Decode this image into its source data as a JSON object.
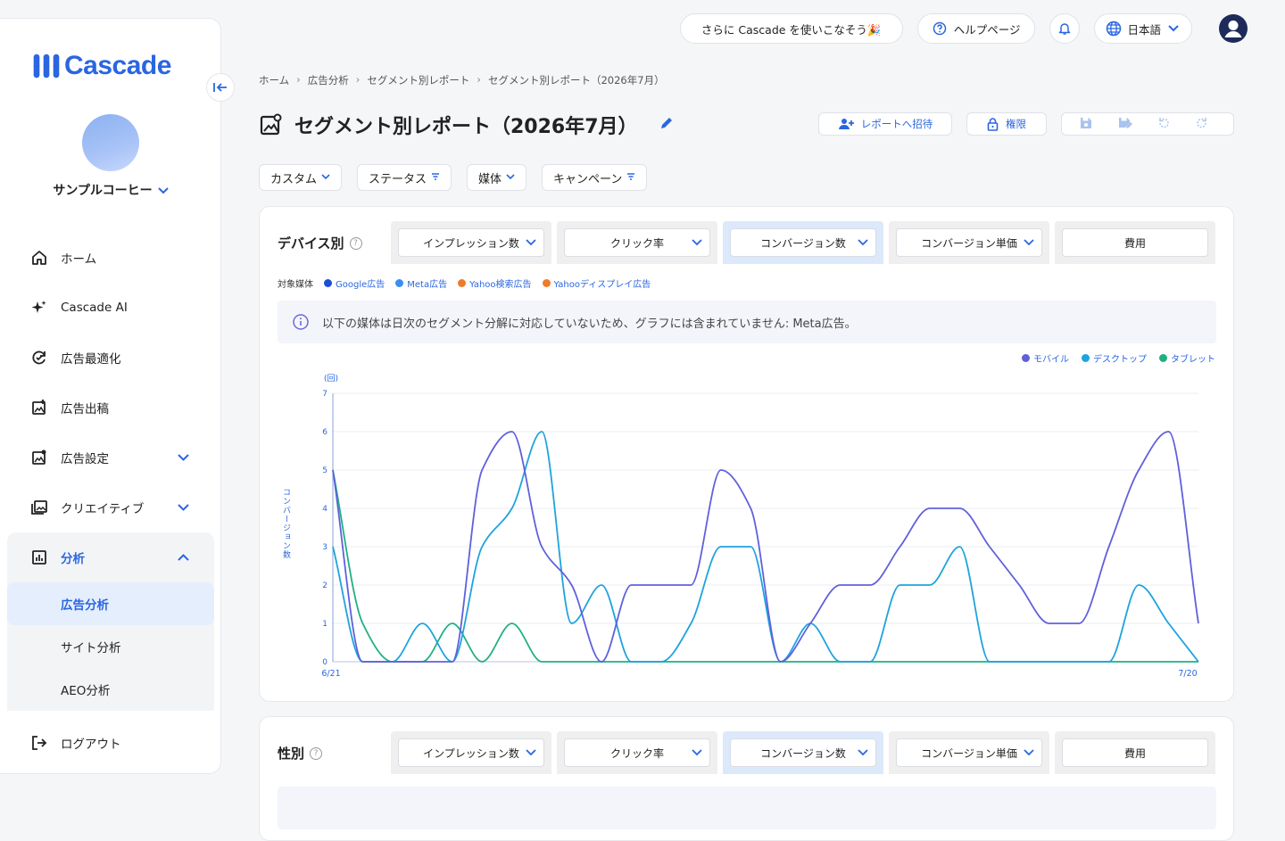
{
  "brand": {
    "name": "Cascade"
  },
  "account": {
    "name": "サンプルコーヒー"
  },
  "nav": {
    "items": [
      {
        "label": "ホーム"
      },
      {
        "label": "Cascade AI"
      },
      {
        "label": "広告最適化"
      },
      {
        "label": "広告出稿"
      },
      {
        "label": "広告設定"
      },
      {
        "label": "クリエイティブ"
      }
    ],
    "group": {
      "label": "分析",
      "subitems": [
        {
          "label": "広告分析"
        },
        {
          "label": "サイト分析"
        },
        {
          "label": "AEO分析"
        }
      ]
    },
    "logout": "ログアウト"
  },
  "topbar": {
    "promo": "さらに Cascade を使いこなそう🎉",
    "help": "ヘルプページ",
    "language": "日本語"
  },
  "breadcrumb": [
    "ホーム",
    "広告分析",
    "セグメント別レポート",
    "セグメント別レポート（2026年7月）"
  ],
  "page": {
    "title": "セグメント別レポート（2026年7月）"
  },
  "actions": {
    "invite": "レポートへ招待",
    "permission": "権限"
  },
  "filters": [
    {
      "label": "カスタム",
      "icon": "chevron"
    },
    {
      "label": "ステータス",
      "icon": "filter"
    },
    {
      "label": "媒体",
      "icon": "chevron"
    },
    {
      "label": "キャンペーン",
      "icon": "filter"
    }
  ],
  "metrics": [
    "インプレッション数",
    "クリック率",
    "コンバージョン数",
    "コンバージョン単価",
    "費用"
  ],
  "device_card": {
    "title": "デバイス別",
    "media_label": "対象媒体",
    "media": [
      {
        "name": "Google広告",
        "color": "#1a4fd6"
      },
      {
        "name": "Meta広告",
        "color": "#3a8ef0"
      },
      {
        "name": "Yahoo検索広告",
        "color": "#f07a2a"
      },
      {
        "name": "Yahooディスプレイ広告",
        "color": "#f07a2a"
      }
    ],
    "notice": "以下の媒体は日次のセグメント分解に対応していないため、グラフには含まれていません: Meta広告。"
  },
  "gender_card": {
    "title": "性別"
  },
  "chart_data": {
    "type": "line",
    "ylabel": "コンバージョン数",
    "yunit": "(回)",
    "ylim": [
      0,
      7
    ],
    "yticks": [
      0,
      1,
      2,
      3,
      4,
      5,
      6,
      7
    ],
    "x_start_label": "6/21",
    "x_end_label": "7/20",
    "x": [
      0,
      1,
      2,
      3,
      4,
      5,
      6,
      7,
      8,
      9,
      10,
      11,
      12,
      13,
      14,
      15,
      16,
      17,
      18,
      19,
      20,
      21,
      22,
      23,
      24,
      25,
      26,
      27,
      28,
      29
    ],
    "series": [
      {
        "name": "モバイル",
        "color": "#6060dc",
        "values": [
          5,
          0,
          0,
          0,
          0,
          5,
          6,
          3,
          2,
          0,
          2,
          2,
          2,
          5,
          4,
          0,
          1,
          2,
          2,
          3,
          4,
          4,
          3,
          2,
          1,
          1,
          3,
          5,
          6,
          1
        ]
      },
      {
        "name": "デスクトップ",
        "color": "#1ea3dd",
        "values": [
          3,
          0,
          0,
          1,
          0,
          3,
          4,
          6,
          1,
          2,
          0,
          0,
          1,
          3,
          3,
          0,
          1,
          0,
          0,
          2,
          2,
          3,
          0,
          0,
          0,
          0,
          0,
          2,
          1,
          0
        ]
      },
      {
        "name": "タブレット",
        "color": "#1fb083",
        "values": [
          5,
          1,
          0,
          0,
          1,
          0,
          1,
          0,
          0,
          0,
          0,
          0,
          0,
          0,
          0,
          0,
          0,
          0,
          0,
          0,
          0,
          0,
          0,
          0,
          0,
          0,
          0,
          0,
          0,
          0
        ]
      }
    ],
    "grid": true,
    "legend": "top-right"
  }
}
